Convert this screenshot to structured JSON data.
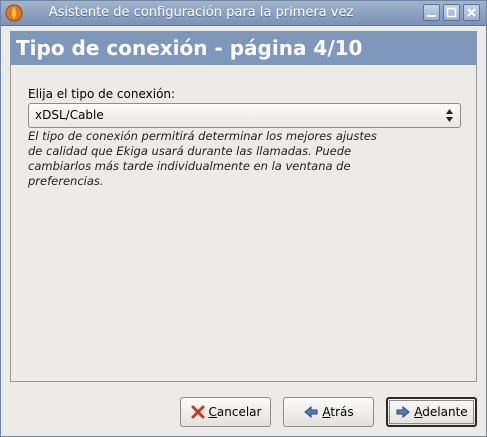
{
  "window": {
    "title": "Asistente de configuración para la primera vez"
  },
  "header": {
    "title": "Tipo de conexión - página 4/10"
  },
  "connection": {
    "label": "Elija el tipo de conexión:",
    "selected": "xDSL/Cable",
    "description": "El tipo de conexión permitirá determinar los mejores ajustes de calidad que Ekiga usará durante las llamadas. Puede cambiarlos más tarde individualmente en la ventana de preferencias."
  },
  "buttons": {
    "cancel": {
      "mnemonic": "C",
      "rest": "ancelar"
    },
    "back": {
      "mnemonic": "A",
      "rest": "trás"
    },
    "forward": {
      "mnemonic": "A",
      "rest": "delante"
    }
  },
  "icons": {
    "app": "ekiga-app-icon",
    "minimize": "minimize-icon",
    "maximize": "maximize-icon",
    "close": "close-icon",
    "cancel": "cancel-x-icon",
    "back": "arrow-left-icon",
    "forward": "arrow-right-icon",
    "combo": "updown-arrows-icon"
  },
  "colors": {
    "titlebar": "#8aa0bf",
    "header": "#7f97bb",
    "cancel_icon": "#c0392b",
    "arrow_icon": "#3d5f95"
  }
}
